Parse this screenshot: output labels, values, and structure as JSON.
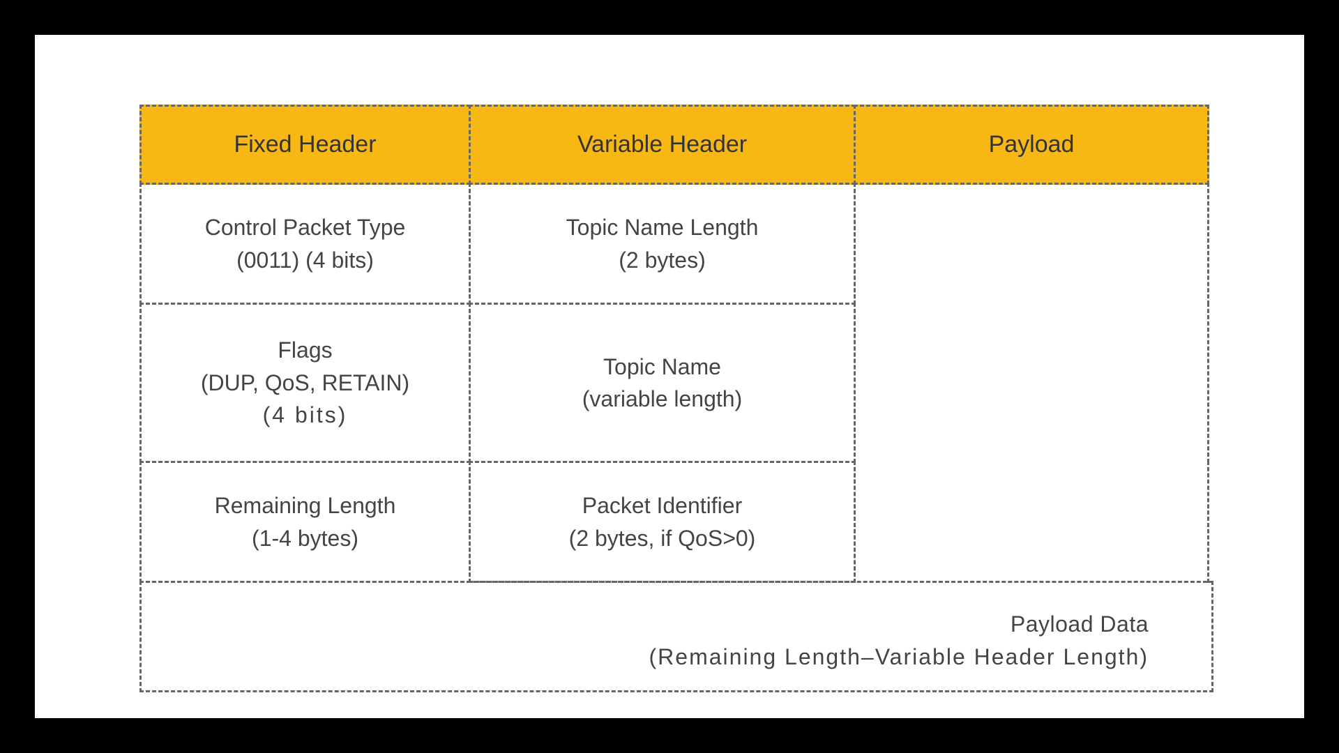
{
  "headers": {
    "fixed": "Fixed Header",
    "variable": "Variable Header",
    "payload": "Payload"
  },
  "fixed": {
    "row1_l1": "Control Packet Type",
    "row1_l2": "(0011) (4 bits)",
    "row2_l1": "Flags",
    "row2_l2": "(DUP, QoS, RETAIN)",
    "row2_l3": "(4 bits)",
    "row3_l1": "Remaining Length",
    "row3_l2": "(1-4 bytes)"
  },
  "variable": {
    "row1_l1": "Topic Name Length",
    "row1_l2": "(2 bytes)",
    "row2_l1": "Topic Name",
    "row2_l2": "(variable length)",
    "row3_l1": "Packet Identifier",
    "row3_l2": "(2 bytes, if QoS>0)"
  },
  "footer": {
    "l1": "Payload Data",
    "l2": "(Remaining Length–Variable Header Length)"
  }
}
